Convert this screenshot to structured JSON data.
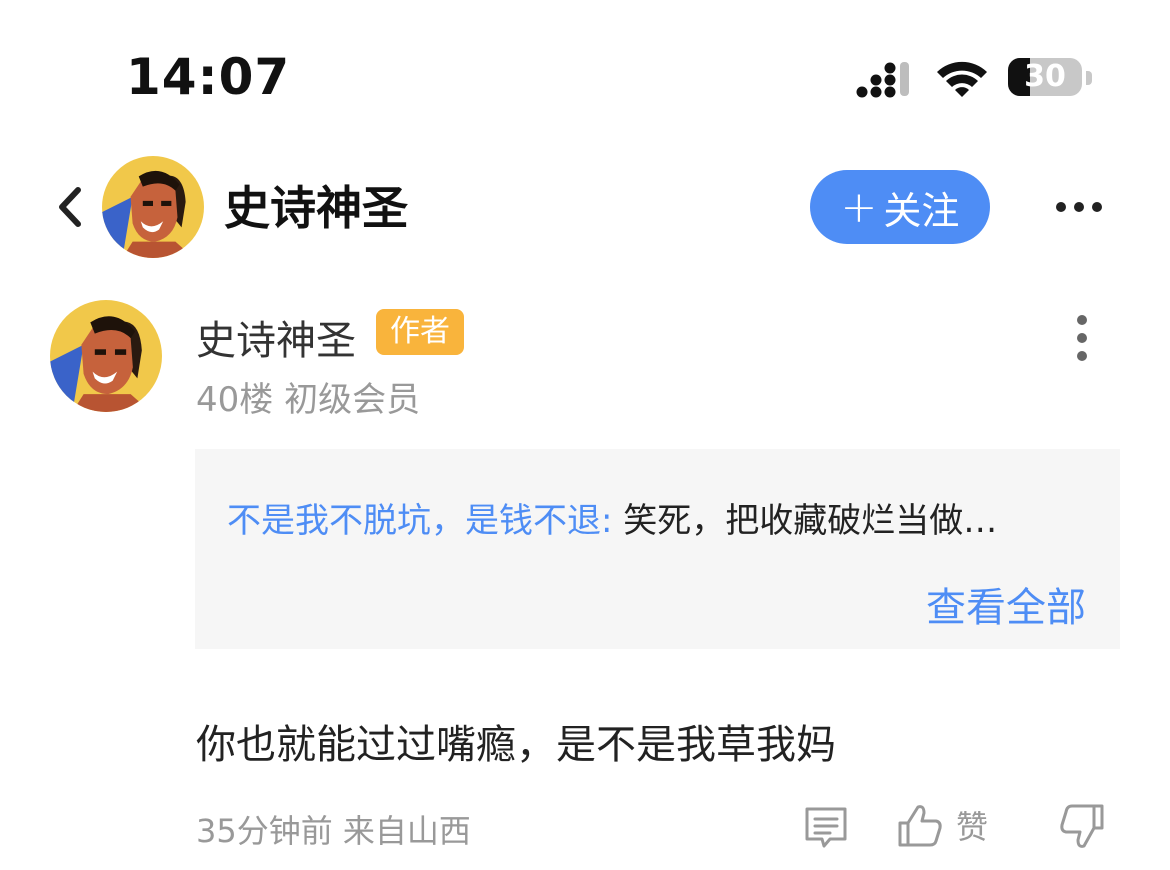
{
  "status_bar": {
    "time": "14:07",
    "battery_level": "30",
    "battery_fraction": 0.3,
    "icons": [
      "signal-icon",
      "wifi-icon",
      "battery-icon"
    ]
  },
  "header": {
    "back_icon": "chevron-left-icon",
    "title": "史诗神圣",
    "follow_plus": "+",
    "follow_label": "关注",
    "more_icon": "more-horizontal-icon"
  },
  "post": {
    "username": "史诗神圣",
    "badge": "作者",
    "floor": "40楼",
    "level": "初级会员",
    "quote": {
      "user": "不是我不脱坑，是钱不退: ",
      "text": "笑死，把收藏破烂当做…",
      "view_all": "查看全部"
    },
    "content": "你也就能过过嘴瘾，是不是我草我妈",
    "time_ago": "35分钟前",
    "location": "来自山西",
    "like_label": "赞"
  },
  "colors": {
    "accent": "#4e8df5",
    "badge": "#f9b43c",
    "quote_bg": "#f6f6f6",
    "muted": "#999999"
  }
}
